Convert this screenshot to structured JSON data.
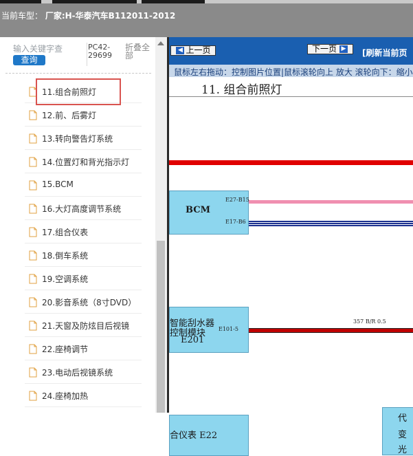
{
  "header": {
    "label": "当前车型：",
    "value": "厂家:H-华泰汽车B112011-2012"
  },
  "sidebar": {
    "search_placeholder": "输入关键字查",
    "query_button": "查询",
    "pc_code": "PC42-29699",
    "collapse_all": "折叠全部",
    "items": [
      {
        "label": "11.组合前照灯"
      },
      {
        "label": "12.前、后雾灯"
      },
      {
        "label": "13.转向警告灯系统"
      },
      {
        "label": "14.位置灯和背光指示灯"
      },
      {
        "label": "15.BCM"
      },
      {
        "label": "16.大灯高度调节系统"
      },
      {
        "label": "17.组合仪表"
      },
      {
        "label": "18.倒车系统"
      },
      {
        "label": "19.空调系统"
      },
      {
        "label": "20.影音系统（8寸DVD）"
      },
      {
        "label": "21.天窗及防炫目后视镜"
      },
      {
        "label": "22.座椅调节"
      },
      {
        "label": "23.电动后视镜系统"
      },
      {
        "label": "24.座椅加热"
      }
    ]
  },
  "toolbar": {
    "prev_label": "上一页",
    "next_label": "下一页",
    "refresh_label": "[刷新当前页"
  },
  "hint_text": "鼠标左右拖动：控制图片位置|鼠标滚轮向上 放大  滚轮向下：缩小",
  "diagram": {
    "title": "11. 组合前照灯",
    "bcm_label": "BCM",
    "bcm_pin_top": "E27-B15",
    "bcm_pin_bottom": "E17-B6",
    "wiper_label_line1": "智能刮水器",
    "wiper_label_line2": "控制模块",
    "wiper_label_line3": "E201",
    "wiper_pin": "E101-5",
    "wire_label": "357 B/R 0.5",
    "cluster_label": "合仪表 E22",
    "right_box_char1": "代",
    "right_box_char2": "变",
    "right_box_char3": "光"
  },
  "colors": {
    "toolbar_blue": "#1a5fb0",
    "query_blue": "#1f78c8",
    "component_fill": "#8dd6ee",
    "wire_red": "#e00000",
    "wire_pink": "#f08fb0",
    "wire_navy": "#1a2f8f",
    "wire_red_dark": "#c00000",
    "highlight_red": "#d9534f"
  },
  "icons": {
    "tree_item": "document-icon",
    "scroll_up": "triangle-up-icon",
    "prev": "arrow-left-icon",
    "next": "arrow-right-icon"
  }
}
